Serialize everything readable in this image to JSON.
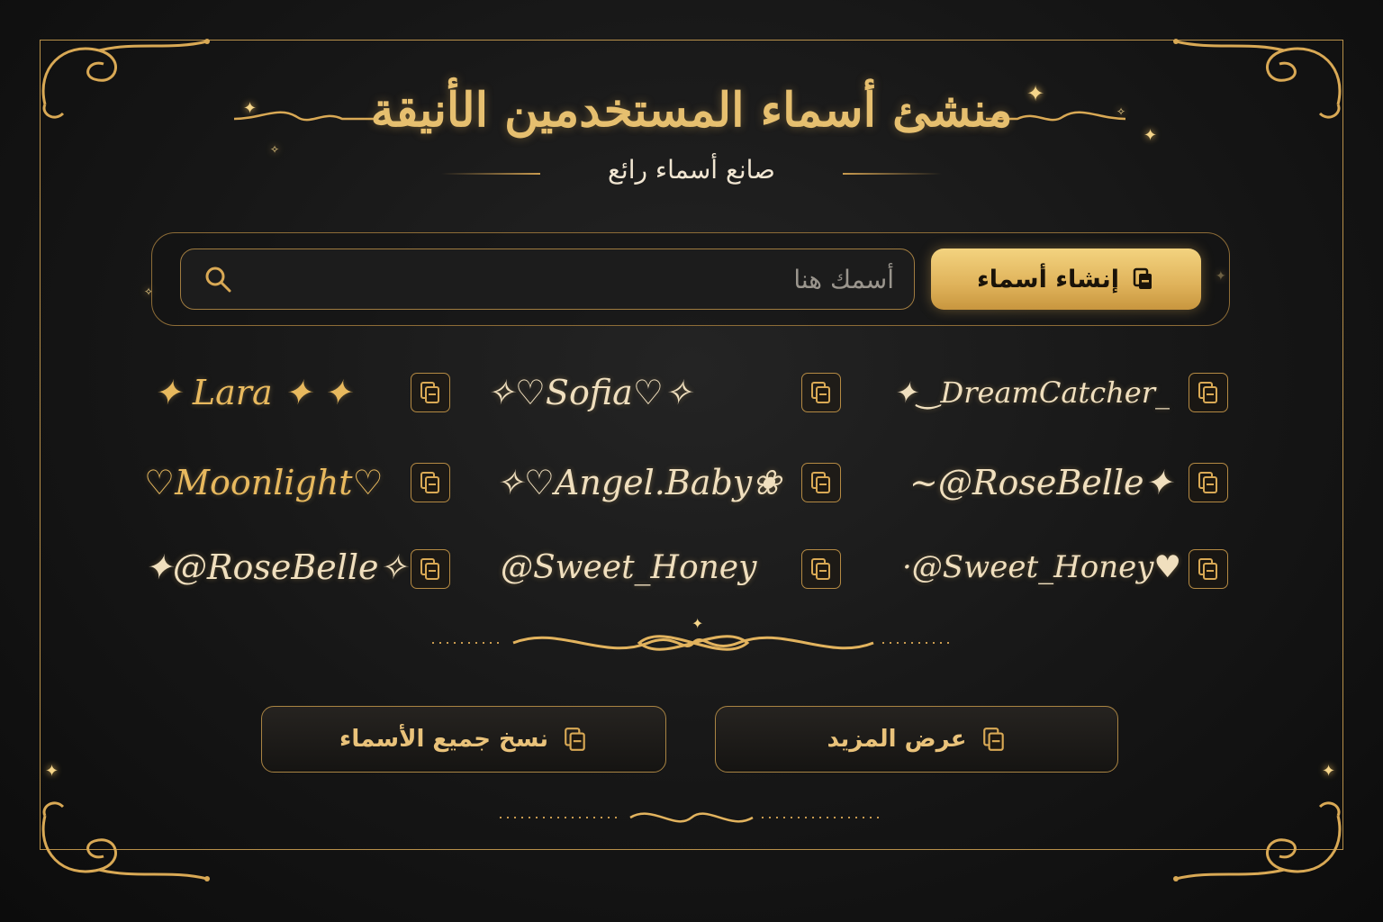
{
  "header": {
    "title": "منشئ أسماء المستخدمين الأنيقة",
    "subtitle": "صانع أسماء رائع"
  },
  "search": {
    "placeholder": "أسمك هنا",
    "icon": "search-icon"
  },
  "generate_button": {
    "label": "إنشاء أسماء",
    "icon": "document-icon"
  },
  "names": [
    {
      "text": "✦ Lara ✦ ✦",
      "style": "gold"
    },
    {
      "text": "✧♡Sofia♡✧",
      "style": "light"
    },
    {
      "text": "✦‿DreamCatcher_",
      "style": "light"
    },
    {
      "text": "♡Moonlight♡",
      "style": "gold"
    },
    {
      "text": "✧♡Angel.Baby❀",
      "style": "light"
    },
    {
      "text": "~@RoseBelle✦",
      "style": "light"
    },
    {
      "text": "✦@RoseBelle✧",
      "style": "light"
    },
    {
      "text": "@Sweet_Honey",
      "style": "light"
    },
    {
      "text": "·@Sweet_Honey♥",
      "style": "light"
    }
  ],
  "actions": {
    "copy_all_label": "نسخ جميع الأسماء",
    "show_more_label": "عرض المزيد"
  },
  "colors": {
    "gold": "#e6bf6f",
    "button_gold": "#dfb25a",
    "background": "#161616",
    "border": "#b8904a"
  }
}
